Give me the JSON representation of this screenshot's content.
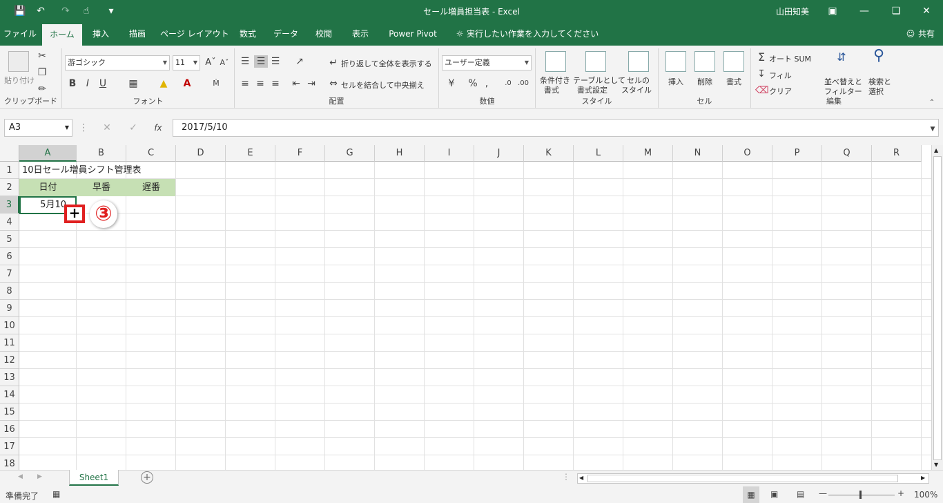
{
  "qat": {
    "save": "💾",
    "undo": "↶",
    "redo": "↷",
    "touch": "☝",
    "more": "▾"
  },
  "title": "セール増員担当表  -  Excel",
  "user": "山田知美",
  "tabs": [
    "ファイル",
    "ホーム",
    "挿入",
    "描画",
    "ページ レイアウト",
    "数式",
    "データ",
    "校閲",
    "表示",
    "Power Pivot"
  ],
  "tellme": "実行したい作業を入力してください",
  "share": "共有",
  "ribbon": {
    "paste": "貼り付け",
    "clipboard": "クリップボード",
    "font_name": "游ゴシック",
    "font_size": "11",
    "font_label": "フォント",
    "wrap": "折り返して全体を表示する",
    "merge": "セルを結合して中央揃え",
    "align_label": "配置",
    "numfmt": "ユーザー定義",
    "number_label": "数値",
    "cond1": "条件付き",
    "cond2": "書式",
    "table1": "テーブルとして",
    "table2": "書式設定",
    "cellstyle1": "セルの",
    "cellstyle2": "スタイル",
    "styles_label": "スタイル",
    "insert": "挿入",
    "delete": "削除",
    "format": "書式",
    "cells_label": "セル",
    "autosum": "オート SUM",
    "fill": "フィル",
    "clear": "クリア",
    "sort1": "並べ替えと",
    "sort2": "フィルター",
    "find1": "検索と",
    "find2": "選択",
    "edit_label": "編集"
  },
  "namebox": "A3",
  "formula": "2017/5/10",
  "columns": [
    "A",
    "B",
    "C",
    "D",
    "E",
    "F",
    "G",
    "H",
    "I",
    "J",
    "K",
    "L",
    "M",
    "N",
    "O",
    "P",
    "Q",
    "R"
  ],
  "rows": [
    "1",
    "2",
    "3",
    "4",
    "5",
    "6",
    "7",
    "8",
    "9",
    "10",
    "11",
    "12",
    "13",
    "14",
    "15",
    "16",
    "17",
    "18"
  ],
  "cells": {
    "A1": "10日セール増員シフト管理表",
    "A2": "日付",
    "B2": "早番",
    "C2": "遅番",
    "A3": "5月10"
  },
  "header_fill": "#c6e0b4",
  "step_marker": "③",
  "sheet_tab": "Sheet1",
  "status": "準備完了",
  "zoom": "100%"
}
